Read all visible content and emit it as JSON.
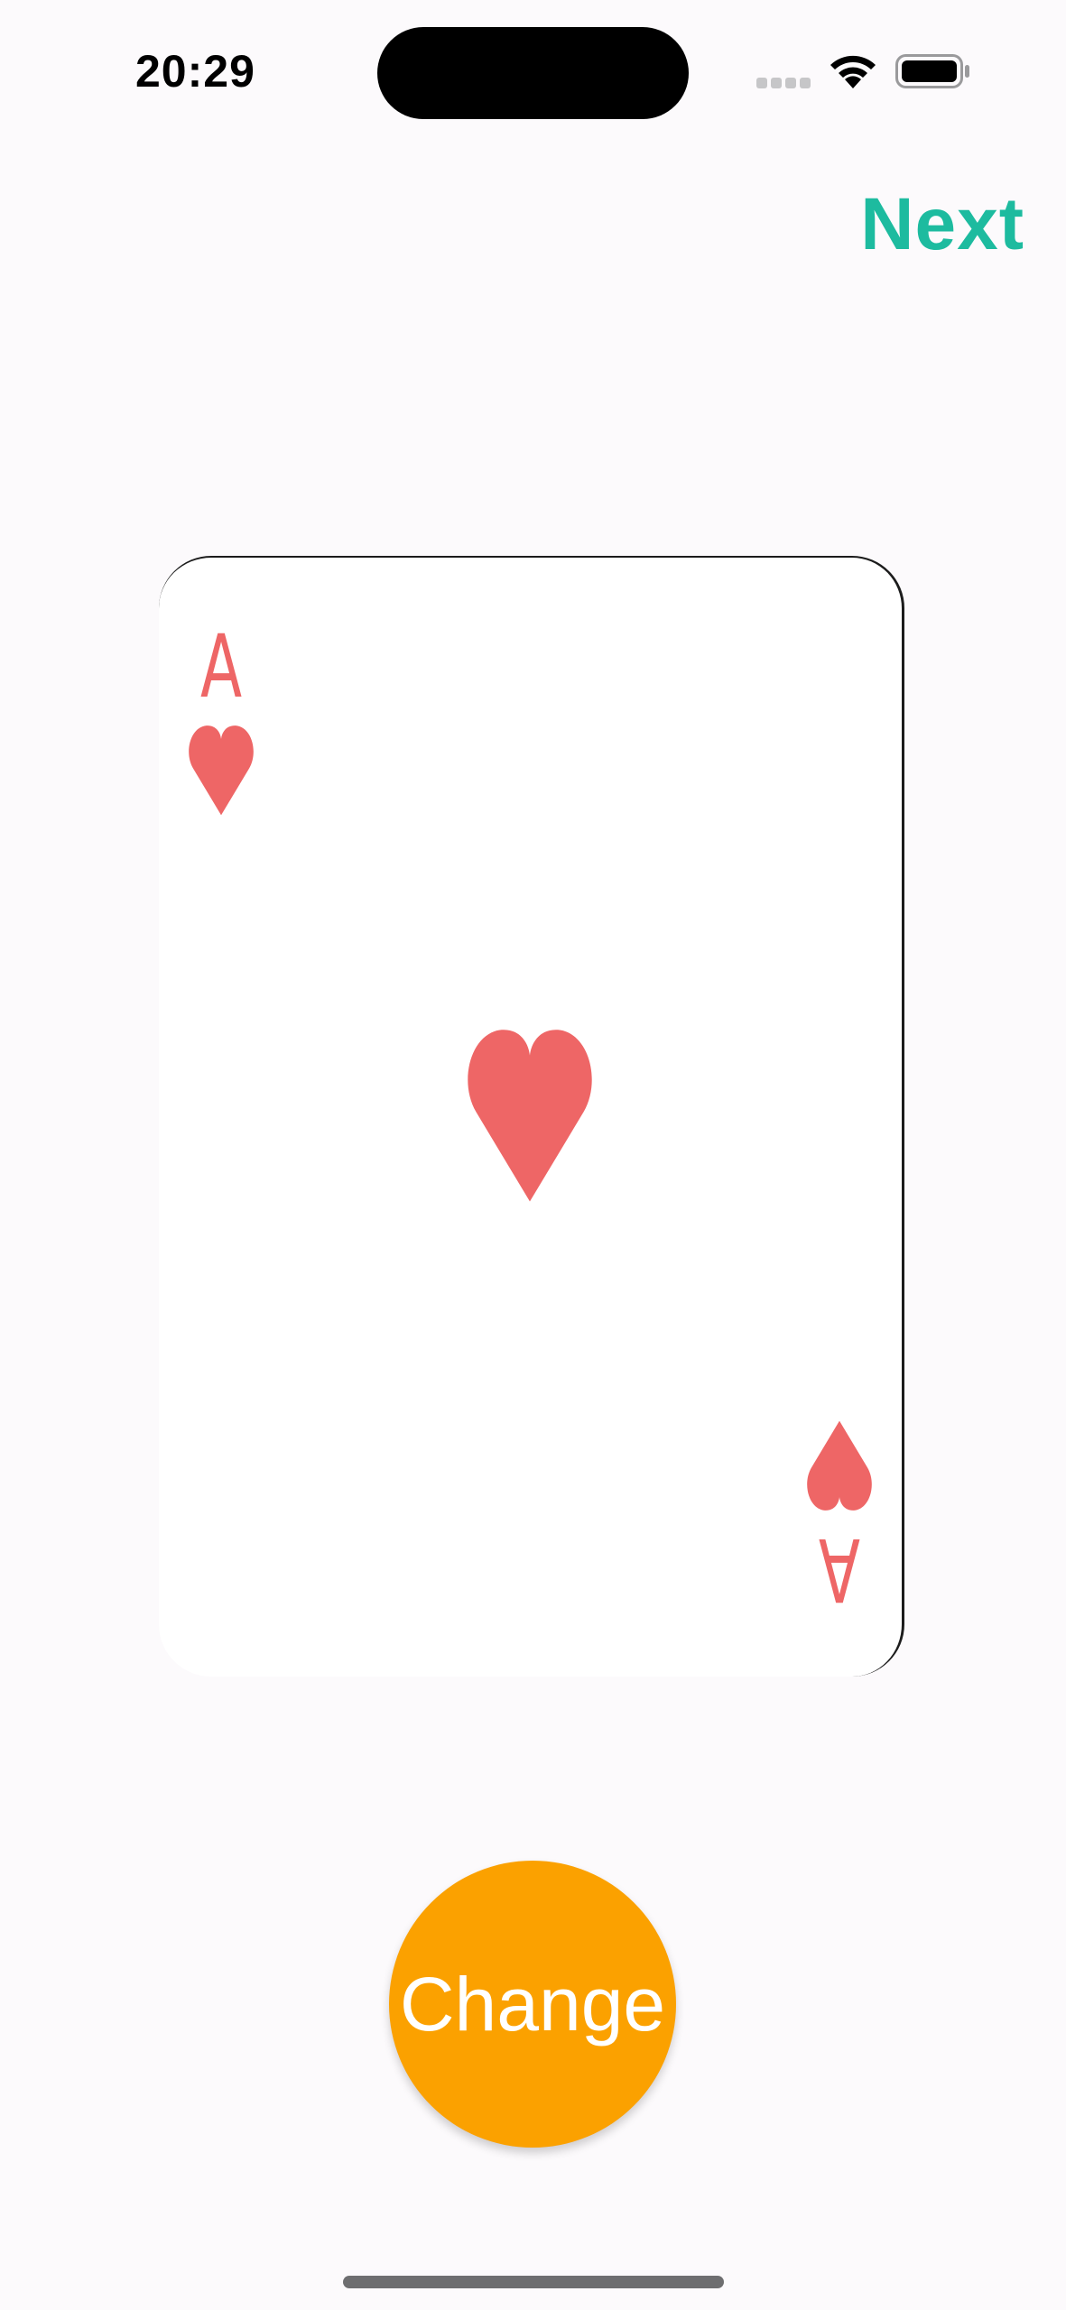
{
  "status_bar": {
    "time": "20:29"
  },
  "header": {
    "next_label": "Next"
  },
  "card": {
    "rank": "A",
    "suit": "hearts",
    "suit_color": "#ee6666",
    "corner_icon": "heart-icon",
    "center_icon": "heart-icon"
  },
  "actions": {
    "change_label": "Change"
  },
  "colors": {
    "accent_next": "#1dbb9f",
    "button_bg": "#fba100",
    "button_text": "#ffffff",
    "background": "#fcfafc"
  }
}
